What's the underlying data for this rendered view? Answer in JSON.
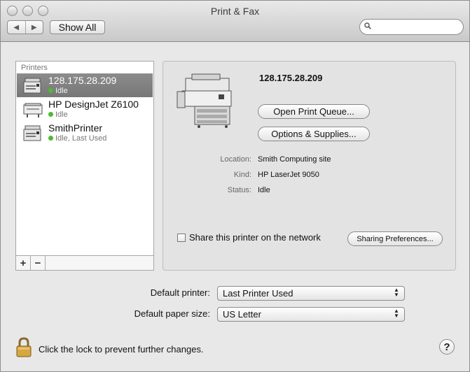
{
  "window": {
    "title": "Print & Fax"
  },
  "toolbar": {
    "show_all_label": "Show All",
    "back_icon": "◀",
    "forward_icon": "▶",
    "search_placeholder": "",
    "search_value": ""
  },
  "printers": {
    "header": "Printers",
    "items": [
      {
        "name": "128.175.28.209",
        "status": "Idle"
      },
      {
        "name": "HP DesignJet Z6100",
        "status": "Idle"
      },
      {
        "name": "SmithPrinter",
        "status": "Idle, Last Used"
      }
    ],
    "add_label": "+",
    "remove_label": "−"
  },
  "details": {
    "name": "128.175.28.209",
    "open_queue_label": "Open Print Queue...",
    "options_label": "Options & Supplies...",
    "location_label": "Location:",
    "location_value": "Smith Computing site",
    "kind_label": "Kind:",
    "kind_value": "HP LaserJet 9050",
    "status_label": "Status:",
    "status_value": "Idle",
    "share_label": "Share this printer on the network",
    "sharing_prefs_label": "Sharing Preferences..."
  },
  "defaults": {
    "printer_label": "Default printer:",
    "printer_value": "Last Printer Used",
    "paper_label": "Default paper size:",
    "paper_value": "US Letter"
  },
  "footer": {
    "lock_text": "Click the lock to prevent further changes.",
    "help_label": "?"
  },
  "colors": {
    "status_green": "#4dbb2f",
    "selection_gray": "#808080"
  }
}
